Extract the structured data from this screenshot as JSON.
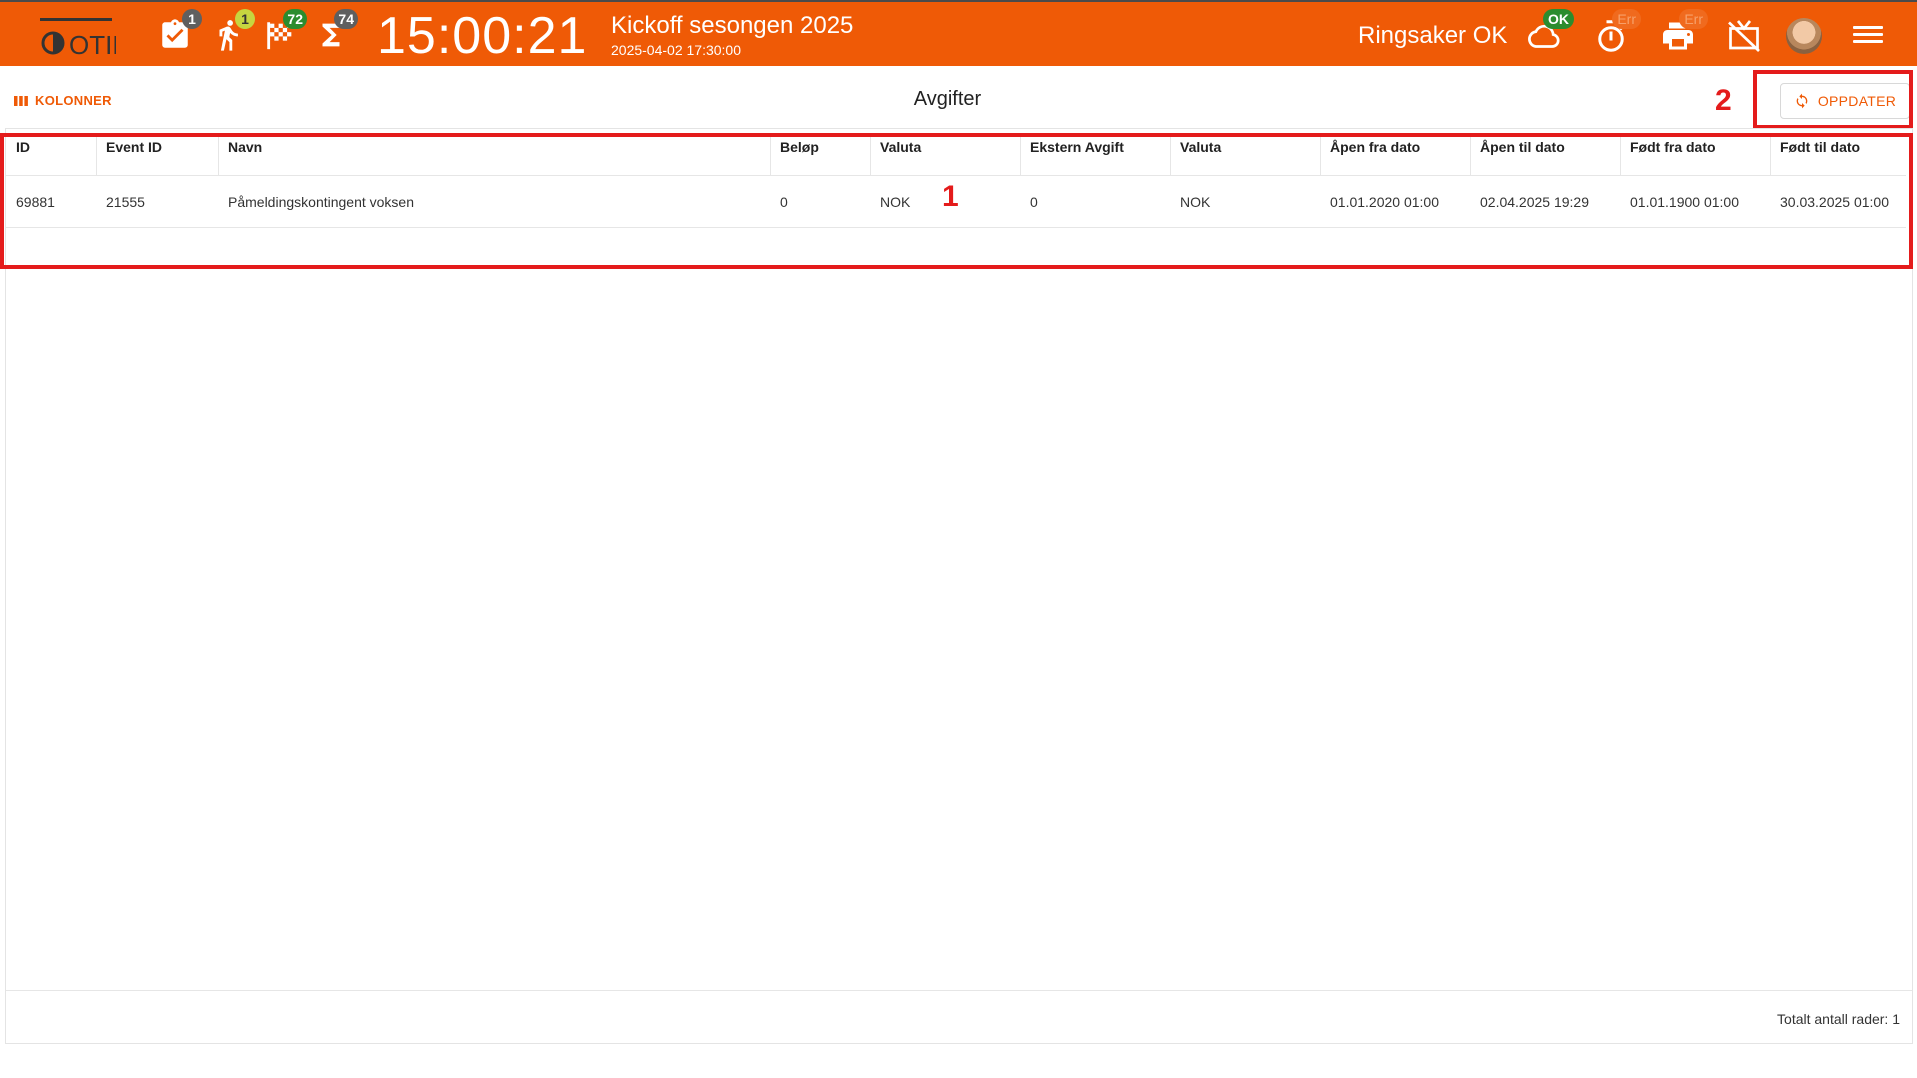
{
  "header": {
    "logo_text": "OTID",
    "status_icons": [
      {
        "icon": "clipboard-check-icon",
        "count": "1",
        "color": "#5f5f5f"
      },
      {
        "icon": "runner-icon",
        "count": "1",
        "color": "#c6d640"
      },
      {
        "icon": "finish-flag-icon",
        "count": "72",
        "color": "#2b8c2e"
      },
      {
        "icon": "sigma-icon",
        "count": "74",
        "color": "#5f5f5f"
      }
    ],
    "clock": "15:00:21",
    "event_title": "Kickoff sesongen 2025",
    "event_datetime": "2025-04-02 17:30:00",
    "club": "Ringsaker OK",
    "cloud_badge": "OK",
    "timer_badge": "Err",
    "printer_badge": "Err",
    "accent_color": "#ef5a06"
  },
  "toolbar": {
    "columns_label": "KOLONNER",
    "page_title": "Avgifter",
    "refresh_label": "OPPDATER",
    "annotation_2": "2"
  },
  "table": {
    "columns": [
      "ID",
      "Event ID",
      "Navn",
      "Beløp",
      "Valuta",
      "Ekstern Avgift",
      "Valuta",
      "Åpen fra dato",
      "Åpen til dato",
      "Født fra dato",
      "Født til dato"
    ],
    "rows": [
      [
        "69881",
        "21555",
        "Påmeldingskontingent voksen",
        "0",
        "NOK",
        "0",
        "NOK",
        "01.01.2020 01:00",
        "02.04.2025 19:29",
        "01.01.1900 01:00",
        "30.03.2025 01:00"
      ]
    ],
    "annotation_1": "1",
    "total_rows": "Totalt antall rader: 1"
  }
}
